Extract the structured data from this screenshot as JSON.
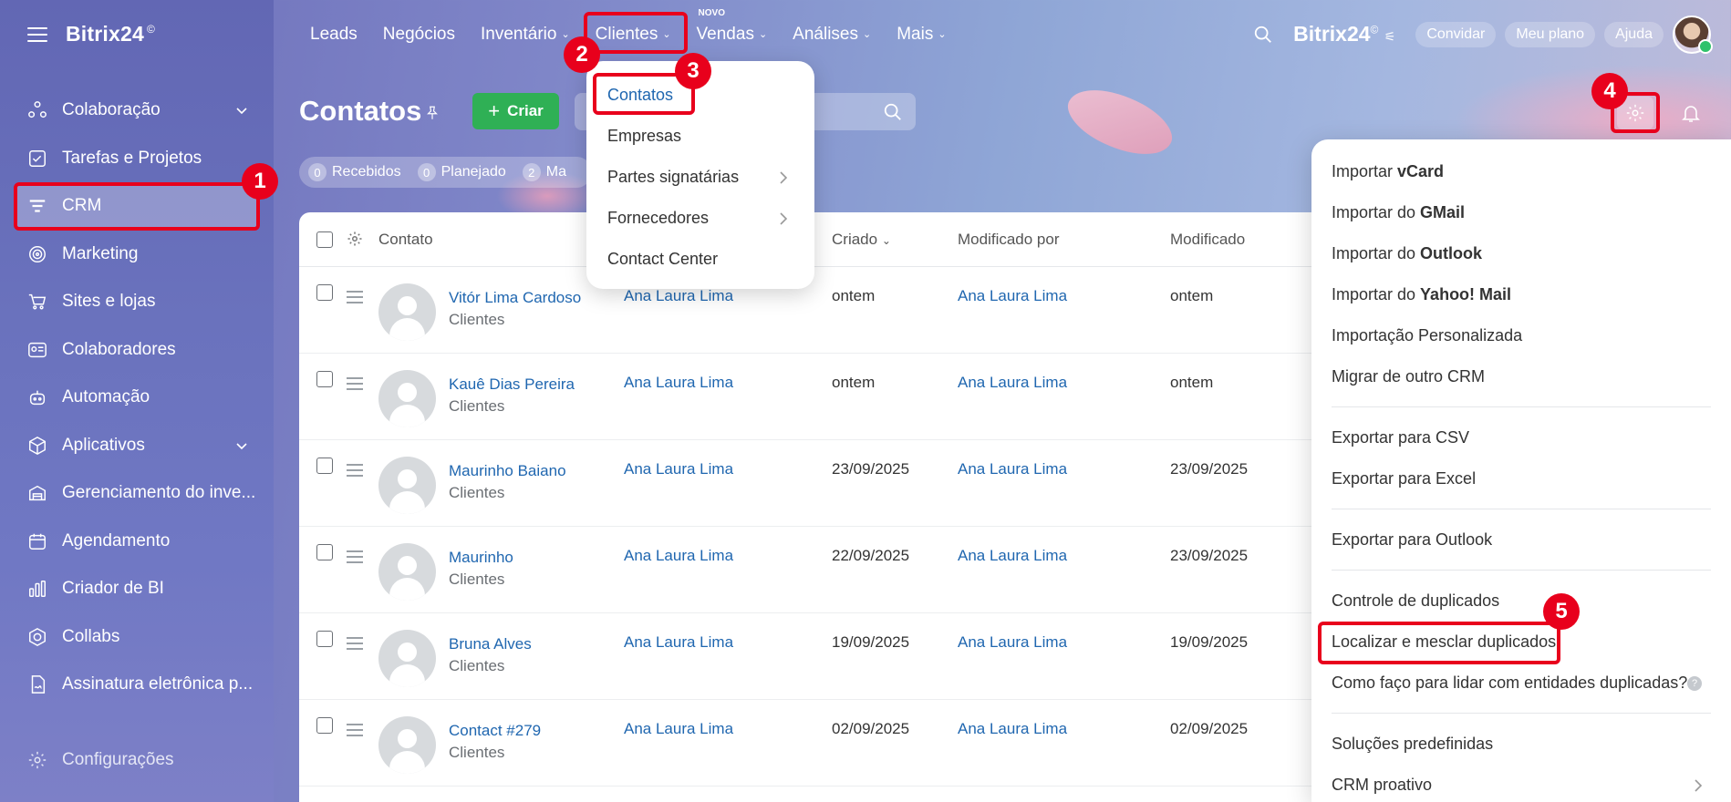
{
  "app": {
    "logo": "Bitrix24",
    "logo_mark": "©"
  },
  "sidebar": {
    "items": [
      {
        "label": "Colaboração",
        "icon": "collaboration-icon",
        "expandable": true
      },
      {
        "label": "Tarefas e Projetos",
        "icon": "tasks-icon"
      },
      {
        "label": "CRM",
        "icon": "crm-icon",
        "active": true
      },
      {
        "label": "Marketing",
        "icon": "marketing-icon"
      },
      {
        "label": "Sites e lojas",
        "icon": "cart-icon"
      },
      {
        "label": "Colaboradores",
        "icon": "employees-icon"
      },
      {
        "label": "Automação",
        "icon": "robot-icon"
      },
      {
        "label": "Aplicativos",
        "icon": "apps-icon",
        "expandable": true
      },
      {
        "label": "Gerenciamento do inve...",
        "icon": "warehouse-icon"
      },
      {
        "label": "Agendamento",
        "icon": "calendar-icon"
      },
      {
        "label": "Criador de BI",
        "icon": "chart-icon"
      },
      {
        "label": "Collabs",
        "icon": "collabs-icon"
      },
      {
        "label": "Assinatura eletrônica p...",
        "icon": "signature-icon"
      }
    ],
    "settings": "Configurações"
  },
  "topnav": {
    "items": [
      "Leads",
      "Negócios",
      "Inventário",
      "Clientes",
      "Vendas",
      "Análises",
      "Mais"
    ],
    "new_badge": "NOVO",
    "right": {
      "logo": "Bitrix24",
      "invite": "Convidar",
      "plan": "Meu plano",
      "help": "Ajuda"
    }
  },
  "page": {
    "title": "Contatos",
    "create_label": "Criar"
  },
  "counters": [
    {
      "count": "0",
      "label": "Recebidos"
    },
    {
      "count": "0",
      "label": "Planejado"
    },
    {
      "count": "2",
      "label": "Ma"
    }
  ],
  "table": {
    "columns": {
      "contact": "Contato",
      "responsible": "",
      "created": "Criado",
      "modified_by": "Modificado por",
      "modified": "Modificado"
    },
    "rows": [
      {
        "name": "Vitór Lima Cardoso",
        "type": "Clientes",
        "responsible": "Ana Laura Lima",
        "created": "ontem",
        "modified_by": "Ana Laura Lima",
        "modified": "ontem"
      },
      {
        "name": "Kauê Dias Pereira",
        "type": "Clientes",
        "responsible": "Ana Laura Lima",
        "created": "ontem",
        "modified_by": "Ana Laura Lima",
        "modified": "ontem"
      },
      {
        "name": "Maurinho Baiano",
        "type": "Clientes",
        "responsible": "Ana Laura Lima",
        "created": "23/09/2025",
        "modified_by": "Ana Laura Lima",
        "modified": "23/09/2025"
      },
      {
        "name": "Maurinho",
        "type": "Clientes",
        "responsible": "Ana Laura Lima",
        "created": "22/09/2025",
        "modified_by": "Ana Laura Lima",
        "modified": "23/09/2025"
      },
      {
        "name": "Bruna Alves",
        "type": "Clientes",
        "responsible": "Ana Laura Lima",
        "created": "19/09/2025",
        "modified_by": "Ana Laura Lima",
        "modified": "19/09/2025"
      },
      {
        "name": "Contact #279",
        "type": "Clientes",
        "responsible": "Ana Laura Lima",
        "created": "02/09/2025",
        "modified_by": "Ana Laura Lima",
        "modified": "02/09/2025"
      }
    ]
  },
  "clientes_dropdown": {
    "items": [
      {
        "label": "Contatos",
        "selected": true
      },
      {
        "label": "Empresas"
      },
      {
        "label": "Partes signatárias",
        "submenu": true
      },
      {
        "label": "Fornecedores",
        "submenu": true
      },
      {
        "label": "Contact Center"
      }
    ]
  },
  "settings_menu": {
    "imports": [
      {
        "prefix": "Importar",
        "bold": "vCard"
      },
      {
        "prefix": "Importar do",
        "bold": "GMail"
      },
      {
        "prefix": "Importar do",
        "bold": "Outlook"
      },
      {
        "prefix": "Importar do",
        "bold": "Yahoo! Mail"
      },
      {
        "prefix": "Importação Personalizada",
        "bold": ""
      },
      {
        "prefix": "Migrar de outro CRM",
        "bold": ""
      }
    ],
    "exports_a": [
      "Exportar para CSV",
      "Exportar para Excel"
    ],
    "exports_b": [
      "Exportar para Outlook"
    ],
    "duplicates": [
      "Controle de duplicados",
      "Localizar e mesclar duplicados",
      "Como faço para lidar com entidades duplicadas?"
    ],
    "help_mark": "?",
    "solutions": [
      "Soluções predefinidas",
      "CRM proativo"
    ]
  },
  "annotations": [
    "1",
    "2",
    "3",
    "4",
    "5"
  ],
  "colors": {
    "highlight": "#e8001c",
    "accent_green": "#2fb055",
    "link": "#2067b0"
  }
}
